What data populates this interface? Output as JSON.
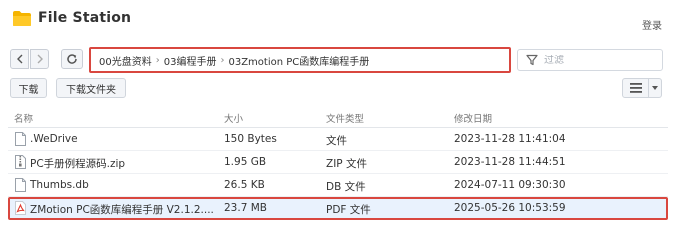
{
  "app": {
    "title": "File Station",
    "login_label": "登录"
  },
  "toolbar": {
    "breadcrumb": [
      "00光盘资料",
      "03编程手册",
      "03Zmotion PC函数库编程手册"
    ],
    "filter_placeholder": "过滤"
  },
  "actions": {
    "download_label": "下载",
    "download_folder_label": "下载文件夹"
  },
  "table": {
    "headers": {
      "name": "名称",
      "size": "大小",
      "type": "文件类型",
      "date": "修改日期"
    },
    "rows": [
      {
        "name": ".WeDrive",
        "size": "150 Bytes",
        "type": "文件",
        "date": "2023-11-28 11:41:04",
        "icon": "generic-file-icon"
      },
      {
        "name": "PC手册例程源码.zip",
        "size": "1.95 GB",
        "type": "ZIP 文件",
        "date": "2023-11-28 11:44:51",
        "icon": "zip-file-icon"
      },
      {
        "name": "Thumbs.db",
        "size": "26.5 KB",
        "type": "DB 文件",
        "date": "2024-07-11 09:30:30",
        "icon": "generic-file-icon"
      },
      {
        "name": "ZMotion PC函数库编程手册 V2.1.2....",
        "size": "23.7 MB",
        "type": "PDF 文件",
        "date": "2025-05-26 10:53:59",
        "icon": "pdf-file-icon",
        "selected": true
      }
    ]
  },
  "colors": {
    "highlight_border": "#d9473f",
    "selected_row_bg": "#e9f2fd",
    "folder_icon": "#f5b400",
    "pdf_icon": "#e03b2f"
  }
}
